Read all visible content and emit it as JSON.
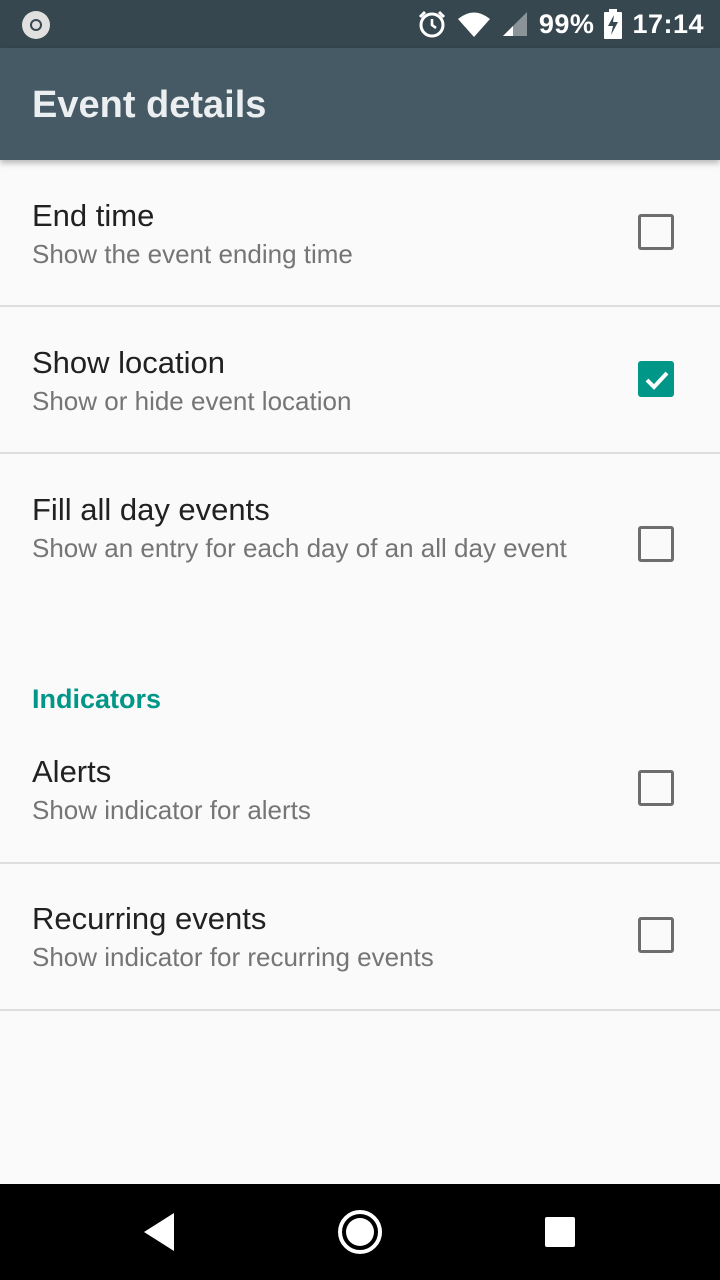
{
  "status_bar": {
    "battery": "99%",
    "time": "17:14",
    "icons": [
      "notification-dot-icon",
      "alarm-icon",
      "wifi-icon",
      "signal-icon",
      "battery-charging-icon"
    ]
  },
  "app_bar": {
    "title": "Event details"
  },
  "preferences": [
    {
      "title": "End time",
      "summary": "Show the event ending time",
      "checked": false
    },
    {
      "title": "Show location",
      "summary": "Show or hide event location",
      "checked": true
    },
    {
      "title": "Fill all day events",
      "summary": "Show an entry for each day of an all day event",
      "checked": false
    }
  ],
  "indicators_section": {
    "title": "Indicators",
    "items": [
      {
        "title": "Alerts",
        "summary": "Show indicator for alerts",
        "checked": false
      },
      {
        "title": "Recurring events",
        "summary": "Show indicator for recurring events",
        "checked": false
      }
    ]
  },
  "colors": {
    "status_bar": "#37474f",
    "app_bar": "#455a64",
    "accent": "#009688"
  },
  "nav_bar": {
    "buttons": [
      "back-icon",
      "home-icon",
      "recents-icon"
    ]
  }
}
